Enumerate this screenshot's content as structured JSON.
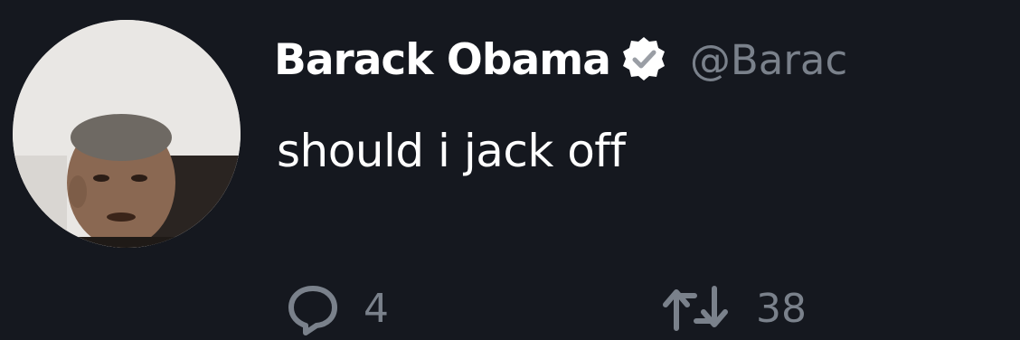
{
  "tweet": {
    "author": {
      "display_name": "Barack Obama",
      "handle": "@Barac",
      "verified": true,
      "avatar_icon": "profile-photo"
    },
    "text": "should i jack off",
    "actions": {
      "reply": {
        "icon": "reply-icon",
        "count": "4"
      },
      "retweet": {
        "icon": "retweet-icon",
        "count": "38"
      }
    }
  },
  "colors": {
    "background": "#15181f",
    "text_primary": "#ffffff",
    "text_secondary": "#7a818b",
    "verified_badge": "#ffffff"
  }
}
